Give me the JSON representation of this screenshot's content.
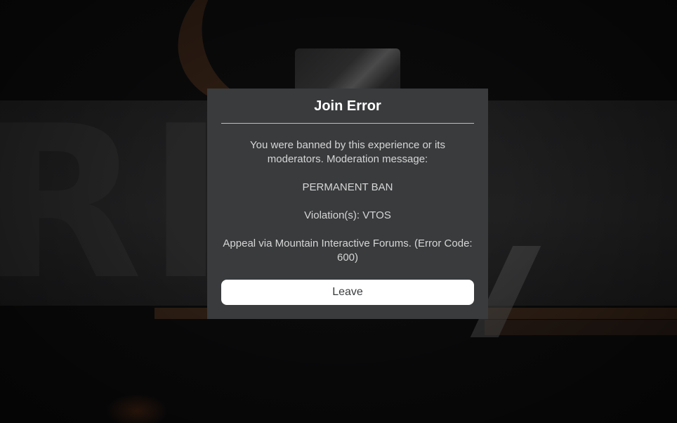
{
  "dialog": {
    "title": "Join Error",
    "message_line1": "You were banned by this experience or its moderators. Moderation message:",
    "message_line2": "PERMANENT BAN",
    "message_line3": "Violation(s): VTOS",
    "message_line4": "Appeal via Mountain Interactive Forums. (Error Code: 600)",
    "leave_label": "Leave"
  },
  "colors": {
    "dialog_background": "#393b3d",
    "title_text": "#ffffff",
    "body_text": "#d6d6d6",
    "button_background": "#ffffff",
    "button_text": "#393b3d",
    "overlay": "#0a0a0b"
  }
}
